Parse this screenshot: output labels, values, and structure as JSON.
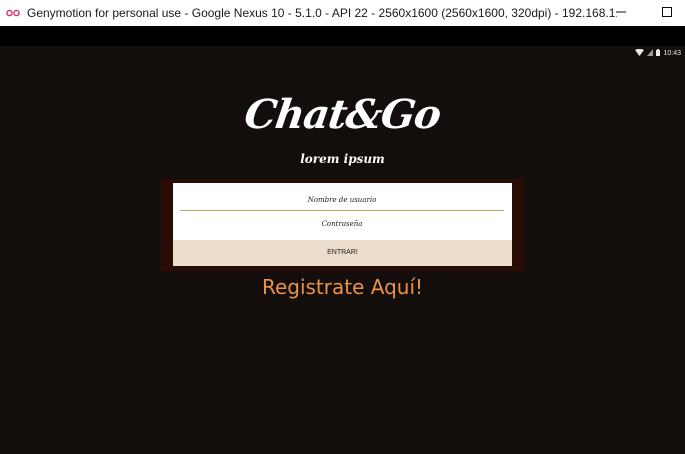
{
  "window": {
    "title": "Genymotion for personal use - Google Nexus 10 - 5.1.0 - API 22 - 2560x1600 (2560x1600, 320dpi) - 192.168.1...",
    "icon": "genymotion-icon",
    "minimize_icon": "minimize-icon",
    "maximize_icon": "maximize-icon"
  },
  "status_bar": {
    "time": "10:43",
    "icons": [
      "wifi-icon",
      "signal-icon",
      "battery-icon"
    ]
  },
  "app": {
    "logo": "Chat&Go",
    "tagline": "lorem ipsum",
    "username_placeholder": "Nombre de usuario",
    "password_placeholder": "Contraseña",
    "enter_label": "ENTRAR!",
    "register_label": "Registrate Aquí!"
  },
  "colors": {
    "background": "#130d0c",
    "form_frame": "#2a0c06",
    "button_bg": "#ecdccb",
    "accent": "#e8924a",
    "field_underline": "#c9a05a"
  }
}
